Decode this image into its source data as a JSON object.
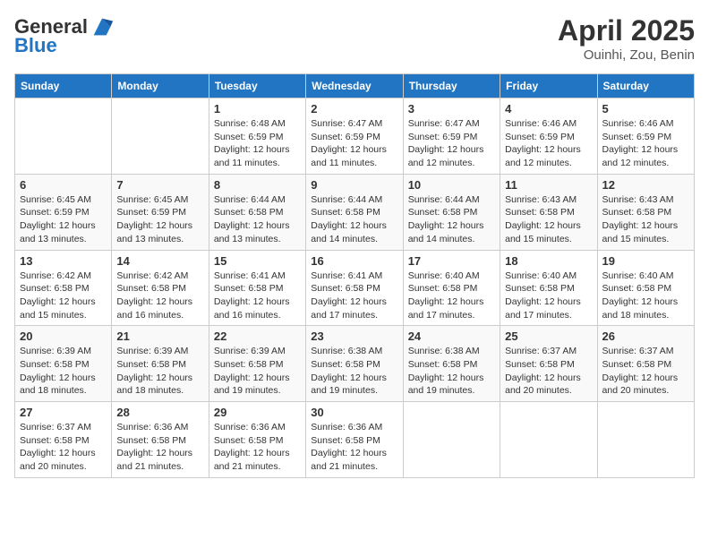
{
  "header": {
    "logo_line1": "General",
    "logo_line2": "Blue",
    "month_year": "April 2025",
    "location": "Ouinhi, Zou, Benin"
  },
  "days_of_week": [
    "Sunday",
    "Monday",
    "Tuesday",
    "Wednesday",
    "Thursday",
    "Friday",
    "Saturday"
  ],
  "weeks": [
    [
      {
        "day": "",
        "info": ""
      },
      {
        "day": "",
        "info": ""
      },
      {
        "day": "1",
        "info": "Sunrise: 6:48 AM\nSunset: 6:59 PM\nDaylight: 12 hours and 11 minutes."
      },
      {
        "day": "2",
        "info": "Sunrise: 6:47 AM\nSunset: 6:59 PM\nDaylight: 12 hours and 11 minutes."
      },
      {
        "day": "3",
        "info": "Sunrise: 6:47 AM\nSunset: 6:59 PM\nDaylight: 12 hours and 12 minutes."
      },
      {
        "day": "4",
        "info": "Sunrise: 6:46 AM\nSunset: 6:59 PM\nDaylight: 12 hours and 12 minutes."
      },
      {
        "day": "5",
        "info": "Sunrise: 6:46 AM\nSunset: 6:59 PM\nDaylight: 12 hours and 12 minutes."
      }
    ],
    [
      {
        "day": "6",
        "info": "Sunrise: 6:45 AM\nSunset: 6:59 PM\nDaylight: 12 hours and 13 minutes."
      },
      {
        "day": "7",
        "info": "Sunrise: 6:45 AM\nSunset: 6:59 PM\nDaylight: 12 hours and 13 minutes."
      },
      {
        "day": "8",
        "info": "Sunrise: 6:44 AM\nSunset: 6:58 PM\nDaylight: 12 hours and 13 minutes."
      },
      {
        "day": "9",
        "info": "Sunrise: 6:44 AM\nSunset: 6:58 PM\nDaylight: 12 hours and 14 minutes."
      },
      {
        "day": "10",
        "info": "Sunrise: 6:44 AM\nSunset: 6:58 PM\nDaylight: 12 hours and 14 minutes."
      },
      {
        "day": "11",
        "info": "Sunrise: 6:43 AM\nSunset: 6:58 PM\nDaylight: 12 hours and 15 minutes."
      },
      {
        "day": "12",
        "info": "Sunrise: 6:43 AM\nSunset: 6:58 PM\nDaylight: 12 hours and 15 minutes."
      }
    ],
    [
      {
        "day": "13",
        "info": "Sunrise: 6:42 AM\nSunset: 6:58 PM\nDaylight: 12 hours and 15 minutes."
      },
      {
        "day": "14",
        "info": "Sunrise: 6:42 AM\nSunset: 6:58 PM\nDaylight: 12 hours and 16 minutes."
      },
      {
        "day": "15",
        "info": "Sunrise: 6:41 AM\nSunset: 6:58 PM\nDaylight: 12 hours and 16 minutes."
      },
      {
        "day": "16",
        "info": "Sunrise: 6:41 AM\nSunset: 6:58 PM\nDaylight: 12 hours and 17 minutes."
      },
      {
        "day": "17",
        "info": "Sunrise: 6:40 AM\nSunset: 6:58 PM\nDaylight: 12 hours and 17 minutes."
      },
      {
        "day": "18",
        "info": "Sunrise: 6:40 AM\nSunset: 6:58 PM\nDaylight: 12 hours and 17 minutes."
      },
      {
        "day": "19",
        "info": "Sunrise: 6:40 AM\nSunset: 6:58 PM\nDaylight: 12 hours and 18 minutes."
      }
    ],
    [
      {
        "day": "20",
        "info": "Sunrise: 6:39 AM\nSunset: 6:58 PM\nDaylight: 12 hours and 18 minutes."
      },
      {
        "day": "21",
        "info": "Sunrise: 6:39 AM\nSunset: 6:58 PM\nDaylight: 12 hours and 18 minutes."
      },
      {
        "day": "22",
        "info": "Sunrise: 6:39 AM\nSunset: 6:58 PM\nDaylight: 12 hours and 19 minutes."
      },
      {
        "day": "23",
        "info": "Sunrise: 6:38 AM\nSunset: 6:58 PM\nDaylight: 12 hours and 19 minutes."
      },
      {
        "day": "24",
        "info": "Sunrise: 6:38 AM\nSunset: 6:58 PM\nDaylight: 12 hours and 19 minutes."
      },
      {
        "day": "25",
        "info": "Sunrise: 6:37 AM\nSunset: 6:58 PM\nDaylight: 12 hours and 20 minutes."
      },
      {
        "day": "26",
        "info": "Sunrise: 6:37 AM\nSunset: 6:58 PM\nDaylight: 12 hours and 20 minutes."
      }
    ],
    [
      {
        "day": "27",
        "info": "Sunrise: 6:37 AM\nSunset: 6:58 PM\nDaylight: 12 hours and 20 minutes."
      },
      {
        "day": "28",
        "info": "Sunrise: 6:36 AM\nSunset: 6:58 PM\nDaylight: 12 hours and 21 minutes."
      },
      {
        "day": "29",
        "info": "Sunrise: 6:36 AM\nSunset: 6:58 PM\nDaylight: 12 hours and 21 minutes."
      },
      {
        "day": "30",
        "info": "Sunrise: 6:36 AM\nSunset: 6:58 PM\nDaylight: 12 hours and 21 minutes."
      },
      {
        "day": "",
        "info": ""
      },
      {
        "day": "",
        "info": ""
      },
      {
        "day": "",
        "info": ""
      }
    ]
  ]
}
